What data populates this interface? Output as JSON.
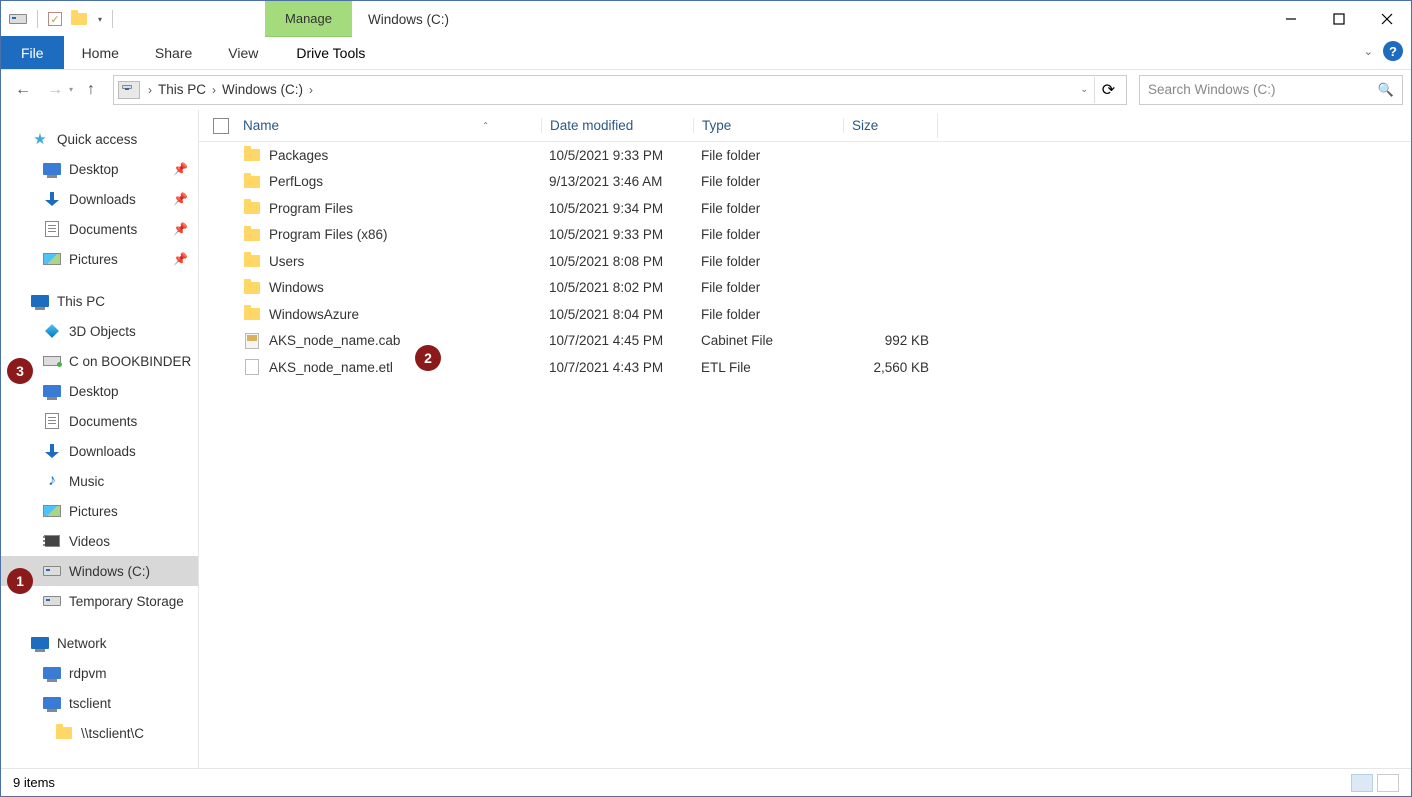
{
  "quick_access_toolbar": {
    "caret_glyph": "▾"
  },
  "contextual_tab": "Manage",
  "window_title": "Windows (C:)",
  "win_controls": {
    "minimize": "minimize",
    "maximize": "maximize",
    "close": "close"
  },
  "ribbon": {
    "file": "File",
    "tabs": [
      "Home",
      "Share",
      "View"
    ],
    "drive_tools": "Drive Tools",
    "expand_glyph": "⌄",
    "help_glyph": "?"
  },
  "nav_arrows": {
    "back": "←",
    "forward": "→",
    "dropdown": "▾",
    "up": "↑"
  },
  "breadcrumb": {
    "sep": "›",
    "parts": [
      "This PC",
      "Windows (C:)"
    ],
    "dropdown_glyph": "⌄",
    "refresh_glyph": "⟳"
  },
  "search": {
    "placeholder": "Search Windows (C:)",
    "icon": "🔍"
  },
  "tree": {
    "quick_access": {
      "label": "Quick access",
      "items": [
        "Desktop",
        "Downloads",
        "Documents",
        "Pictures"
      ],
      "pinned_glyph": "📌"
    },
    "this_pc": {
      "label": "This PC",
      "items": [
        {
          "label": "3D Objects"
        },
        {
          "label": "C on BOOKBINDER"
        },
        {
          "label": "Desktop"
        },
        {
          "label": "Documents"
        },
        {
          "label": "Downloads"
        },
        {
          "label": "Music"
        },
        {
          "label": "Pictures"
        },
        {
          "label": "Videos"
        },
        {
          "label": "Windows (C:)",
          "selected": true
        },
        {
          "label": "Temporary Storage"
        }
      ]
    },
    "network": {
      "label": "Network",
      "items": [
        "rdpvm",
        "tsclient"
      ],
      "sub": [
        "\\\\tsclient\\C"
      ]
    }
  },
  "columns": {
    "name": "Name",
    "date": "Date modified",
    "type": "Type",
    "size": "Size",
    "sort_glyph": "⌃"
  },
  "files": [
    {
      "name": "Packages",
      "date": "10/5/2021 9:33 PM",
      "type": "File folder",
      "size": "",
      "icon": "folder"
    },
    {
      "name": "PerfLogs",
      "date": "9/13/2021 3:46 AM",
      "type": "File folder",
      "size": "",
      "icon": "folder"
    },
    {
      "name": "Program Files",
      "date": "10/5/2021 9:34 PM",
      "type": "File folder",
      "size": "",
      "icon": "folder"
    },
    {
      "name": "Program Files (x86)",
      "date": "10/5/2021 9:33 PM",
      "type": "File folder",
      "size": "",
      "icon": "folder"
    },
    {
      "name": "Users",
      "date": "10/5/2021 8:08 PM",
      "type": "File folder",
      "size": "",
      "icon": "folder"
    },
    {
      "name": "Windows",
      "date": "10/5/2021 8:02 PM",
      "type": "File folder",
      "size": "",
      "icon": "folder"
    },
    {
      "name": "WindowsAzure",
      "date": "10/5/2021 8:04 PM",
      "type": "File folder",
      "size": "",
      "icon": "folder"
    },
    {
      "name": "AKS_node_name.cab",
      "date": "10/7/2021 4:45 PM",
      "type": "Cabinet File",
      "size": "992 KB",
      "icon": "cab"
    },
    {
      "name": "AKS_node_name.etl",
      "date": "10/7/2021 4:43 PM",
      "type": "ETL File",
      "size": "2,560 KB",
      "icon": "file"
    }
  ],
  "status": {
    "items": "9 items"
  },
  "callouts": {
    "c1": "1",
    "c2": "2",
    "c3": "3"
  }
}
